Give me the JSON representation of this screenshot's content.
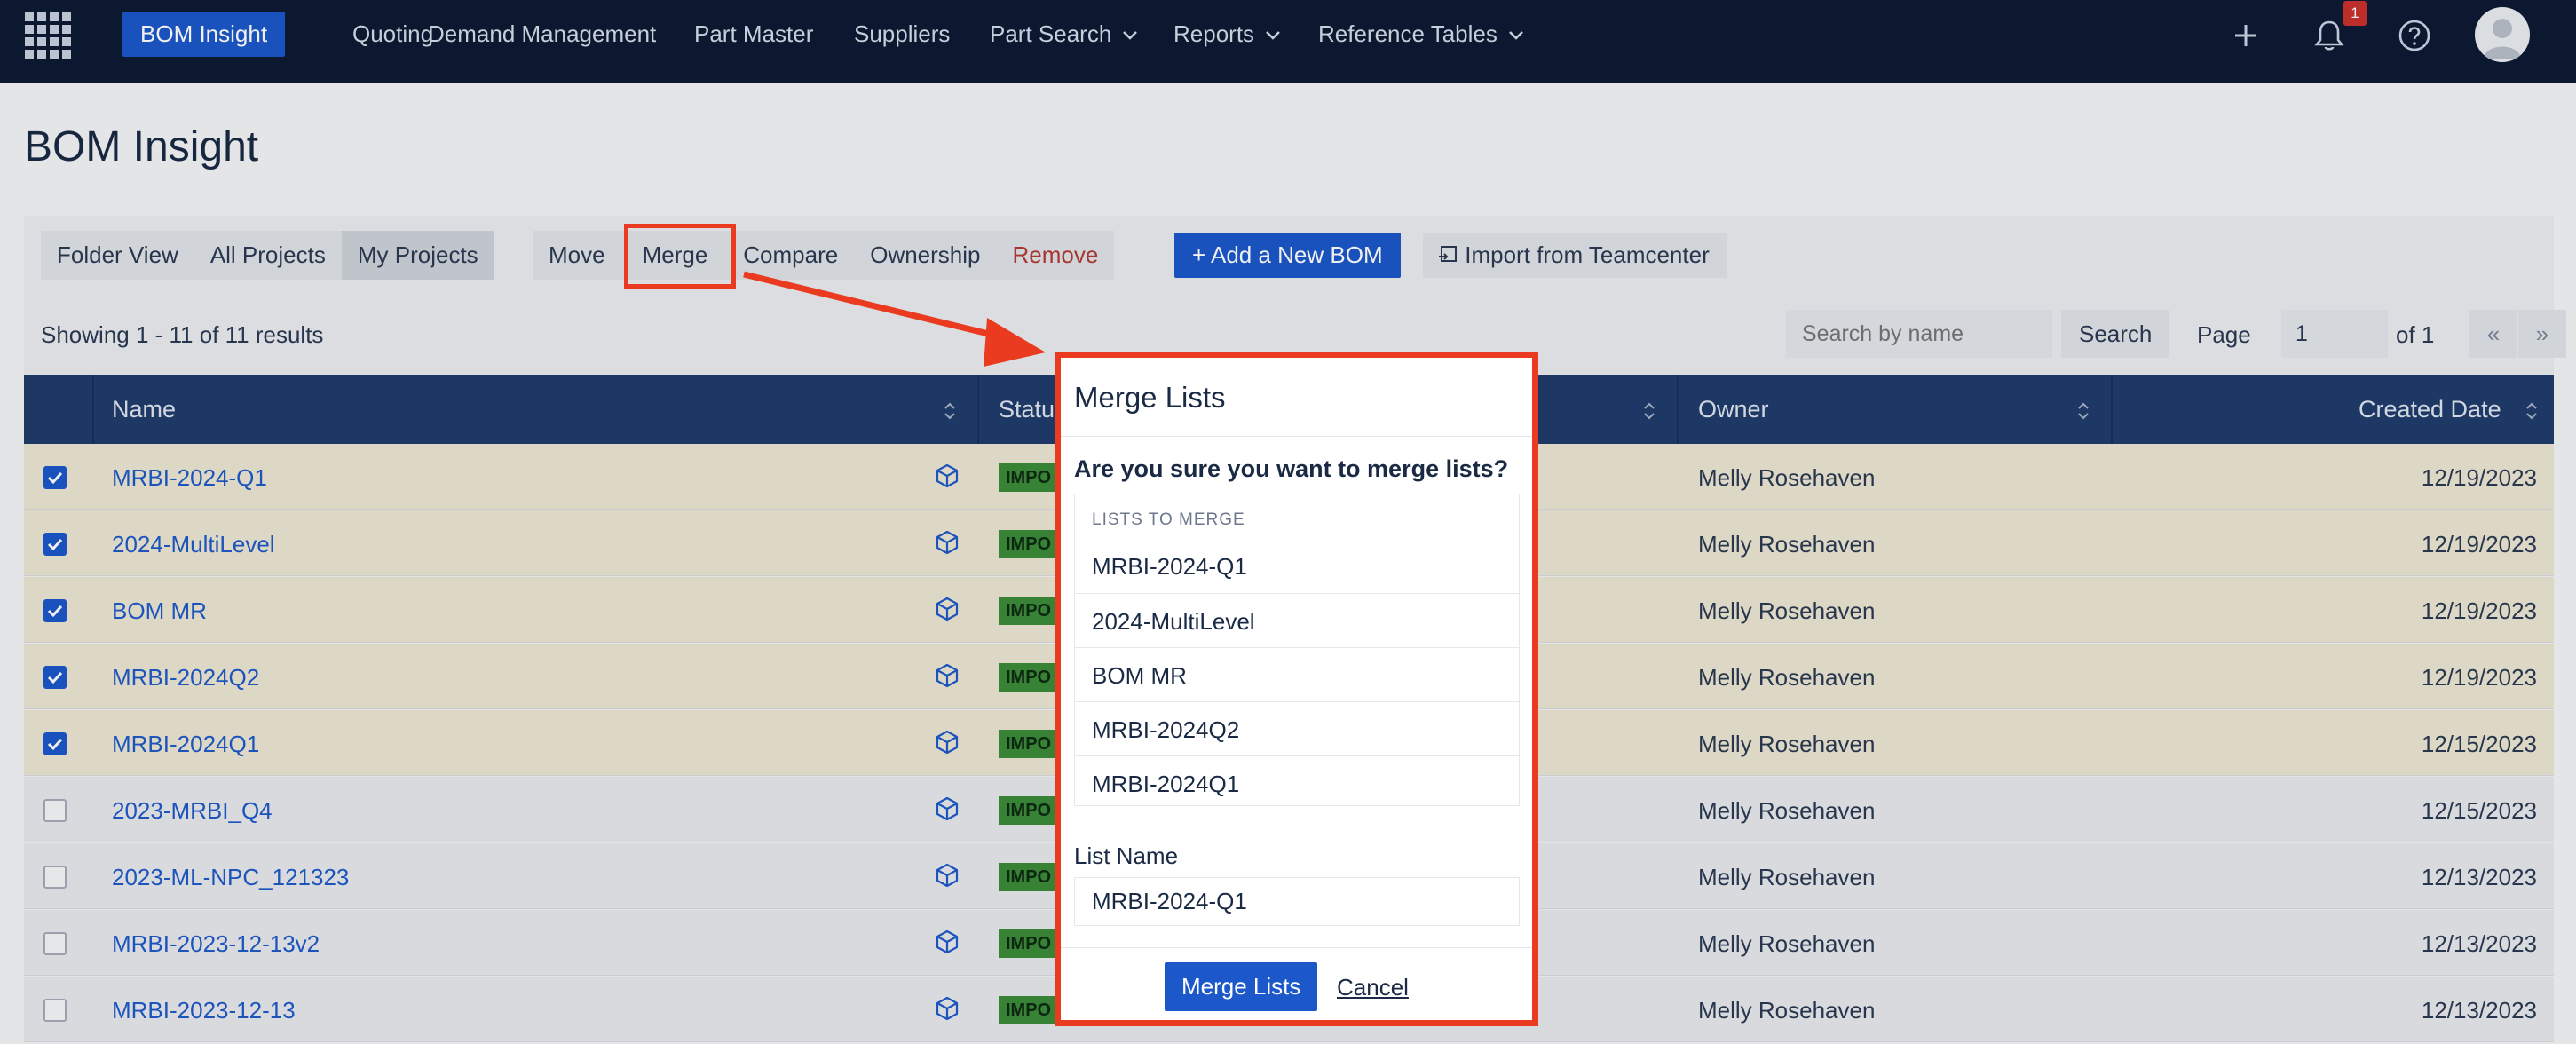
{
  "nav": {
    "items": [
      {
        "label": "BOM Insight",
        "dropdown": false
      },
      {
        "label": "Quoting",
        "dropdown": false
      },
      {
        "label": "Demand Management",
        "dropdown": false
      },
      {
        "label": "Part Master",
        "dropdown": false
      },
      {
        "label": "Suppliers",
        "dropdown": false
      },
      {
        "label": "Part Search",
        "dropdown": true
      },
      {
        "label": "Reports",
        "dropdown": true
      },
      {
        "label": "Reference Tables",
        "dropdown": true
      }
    ],
    "notification_count": "1",
    "icons": [
      "app-grid-icon",
      "plus-icon",
      "bell-icon",
      "help-icon",
      "avatar"
    ]
  },
  "page": {
    "title": "BOM Insight"
  },
  "toolbar": {
    "view_buttons": [
      "Folder View",
      "All Projects",
      "My Projects"
    ],
    "selected_view": "My Projects",
    "actions": [
      "Move",
      "Merge",
      "Compare",
      "Ownership",
      "Remove"
    ],
    "add_bom_label": "Add a New BOM",
    "import_label": "Import from Teamcenter"
  },
  "results": {
    "summary": "Showing 1 - 11 of 11 results",
    "search_placeholder": "Search by name",
    "search_label": "Search",
    "page_label": "Page",
    "page_value": "1",
    "page_of": "of 1",
    "prev": "«",
    "next": "»"
  },
  "table": {
    "columns": [
      "Name",
      "Statu",
      "Owner",
      "Created Date"
    ],
    "rows": [
      {
        "name": "MRBI-2024-Q1",
        "checked": true,
        "status": "IMPO",
        "owner": "Melly Rosehaven",
        "date": "12/19/2023"
      },
      {
        "name": "2024-MultiLevel",
        "checked": true,
        "status": "IMPO",
        "owner": "Melly Rosehaven",
        "date": "12/19/2023"
      },
      {
        "name": "BOM MR",
        "checked": true,
        "status": "IMPO",
        "owner": "Melly Rosehaven",
        "date": "12/19/2023"
      },
      {
        "name": "MRBI-2024Q2",
        "checked": true,
        "status": "IMPO",
        "owner": "Melly Rosehaven",
        "date": "12/19/2023"
      },
      {
        "name": "MRBI-2024Q1",
        "checked": true,
        "status": "IMPO",
        "owner": "Melly Rosehaven",
        "date": "12/15/2023"
      },
      {
        "name": "2023-MRBI_Q4",
        "checked": false,
        "status": "IMPO",
        "owner": "Melly Rosehaven",
        "date": "12/15/2023"
      },
      {
        "name": "2023-ML-NPC_121323",
        "checked": false,
        "status": "IMPO",
        "owner": "Melly Rosehaven",
        "date": "12/13/2023"
      },
      {
        "name": "MRBI-2023-12-13v2",
        "checked": false,
        "status": "IMPO",
        "owner": "Melly Rosehaven",
        "date": "12/13/2023"
      },
      {
        "name": "MRBI-2023-12-13",
        "checked": false,
        "status": "IMPO",
        "owner": "Melly Rosehaven",
        "date": "12/13/2023"
      }
    ]
  },
  "modal": {
    "title": "Merge Lists",
    "question": "Are you sure you want to merge lists?",
    "lists_header": "LISTS TO MERGE",
    "lists": [
      "MRBI-2024-Q1",
      "2024-MultiLevel",
      "BOM MR",
      "MRBI-2024Q2",
      "MRBI-2024Q1"
    ],
    "list_name_label": "List Name",
    "list_name_value": "MRBI-2024-Q1",
    "confirm_label": "Merge Lists",
    "cancel_label": "Cancel"
  },
  "colors": {
    "nav_bg": "#0c1a33",
    "accent": "#1c58c9",
    "table_head": "#1f3c6b",
    "highlight": "#ea3a1f",
    "status_green": "#3c8b3a"
  }
}
